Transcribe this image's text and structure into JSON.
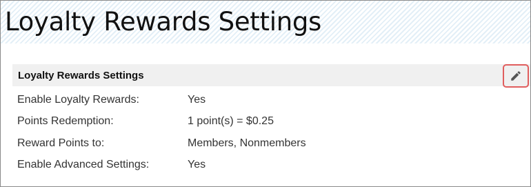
{
  "page": {
    "title": "Loyalty Rewards Settings"
  },
  "panel": {
    "title": "Loyalty Rewards Settings",
    "edit_icon": "pencil-icon",
    "rows": [
      {
        "label": "Enable Loyalty Rewards:",
        "value": "Yes"
      },
      {
        "label": "Points Redemption:",
        "value": "1 point(s) = $0.25"
      },
      {
        "label": "Reward Points to:",
        "value": "Members, Nonmembers"
      },
      {
        "label": "Enable Advanced Settings:",
        "value": "Yes"
      }
    ]
  },
  "colors": {
    "header_stripe": "#e3eff7",
    "panel_header_bg": "#f0f0f0",
    "edit_highlight": "#e05d5d",
    "text": "#333333"
  }
}
